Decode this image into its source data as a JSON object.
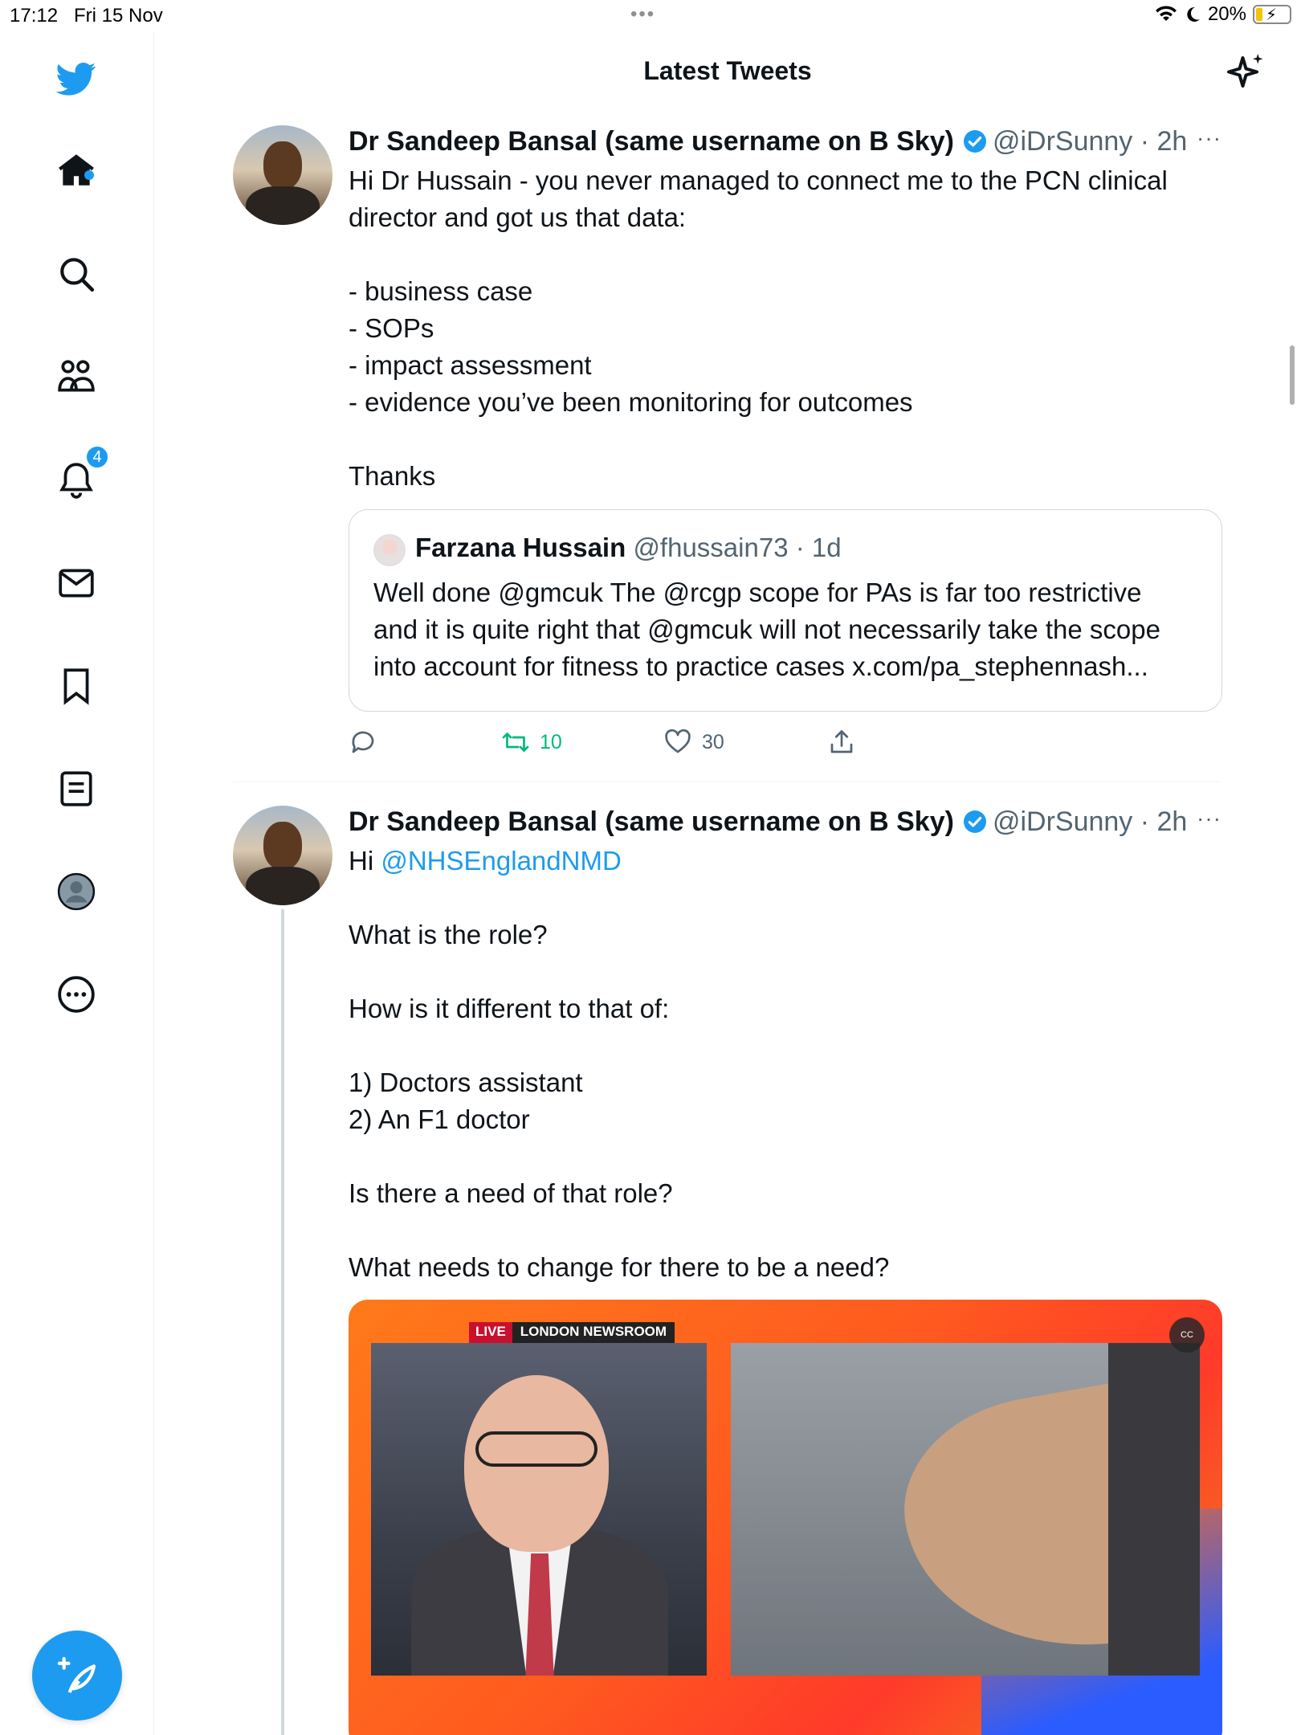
{
  "status_bar": {
    "time": "17:12",
    "date": "Fri 15 Nov",
    "battery": "20%"
  },
  "header": {
    "title": "Latest Tweets"
  },
  "sidebar": {
    "notifications_badge": "4"
  },
  "tweets": [
    {
      "name": "Dr Sandeep Bansal (same username on B Sky)",
      "handle_time": "@iDrSunny · 2h",
      "more": "···",
      "body": "Hi Dr Hussain - you never managed to connect me to the PCN clinical director and got us that data:\n\n- business case\n- SOPs\n- impact assessment\n- evidence you’ve been monitoring for outcomes\n\nThanks",
      "quote": {
        "name": "Farzana Hussain",
        "handle_time": "@fhussain73 · 1d",
        "text": "Well done @gmcuk The @rcgp scope for PAs is far too restrictive\nand it is quite right that @gmcuk will not necessarily take the scope\ninto account for fitness to practice cases x.com/pa_stephennash..."
      },
      "retweets": "10",
      "likes": "30"
    },
    {
      "name": "Dr Sandeep Bansal (same username on B Sky)",
      "handle_time": "@iDrSunny · 2h",
      "more": "···",
      "greeting": "Hi ",
      "mention": "@NHSEnglandNMD",
      "body": "What is the role?\n\nHow is it different to that of:\n\n1) Doctors assistant\n2) An F1 doctor\n\nIs there a need of that role?\n\nWhat needs to change for there to be a need?",
      "media": {
        "live": "LIVE",
        "channel": "LONDON NEWSROOM",
        "cc": "CC"
      }
    }
  ],
  "colors": {
    "accent": "#1d9bf0",
    "retweet": "#00ba7c",
    "muted": "#536471"
  },
  "icons": [
    "twitter-logo-icon",
    "home-icon",
    "search-icon",
    "communities-icon",
    "bell-icon",
    "mail-icon",
    "bookmark-icon",
    "list-icon",
    "profile-icon",
    "more-circle-icon",
    "compose-icon",
    "sparkle-icon",
    "verified-icon",
    "reply-icon",
    "retweet-icon",
    "like-icon",
    "share-icon"
  ]
}
